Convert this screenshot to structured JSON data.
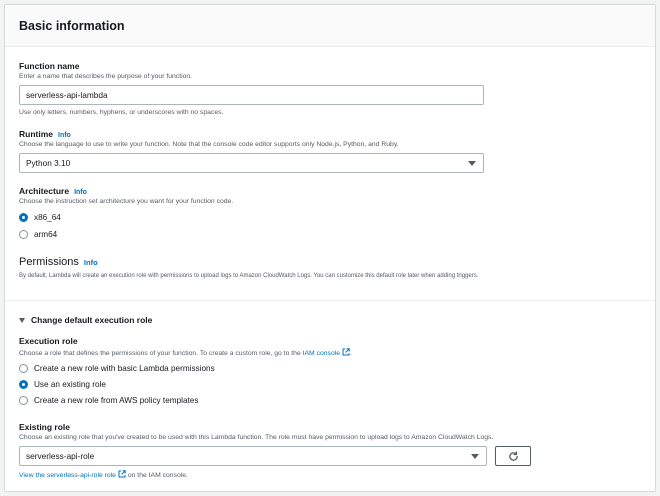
{
  "header": {
    "title": "Basic information"
  },
  "function_name": {
    "label": "Function name",
    "description": "Enter a name that describes the purpose of your function.",
    "value": "serverless-api-lambda",
    "hint": "Use only letters, numbers, hyphens, or underscores with no spaces."
  },
  "runtime": {
    "label": "Runtime",
    "info": "Info",
    "description": "Choose the language to use to write your function. Note that the console code editor supports only Node.js, Python, and Ruby.",
    "selected": "Python 3.10"
  },
  "architecture": {
    "label": "Architecture",
    "info": "Info",
    "description": "Choose the instruction set architecture you want for your function code.",
    "options": [
      {
        "label": "x86_64",
        "checked": true
      },
      {
        "label": "arm64",
        "checked": false
      }
    ]
  },
  "permissions": {
    "title": "Permissions",
    "info": "Info",
    "description": "By default, Lambda will create an execution role with permissions to upload logs to Amazon CloudWatch Logs. You can customize this default role later when adding triggers."
  },
  "execution_role_toggle": {
    "label": "Change default execution role"
  },
  "execution_role": {
    "label": "Execution role",
    "description_prefix": "Choose a role that defines the permissions of your function. To create a custom role, go to the ",
    "iam_link": "IAM console",
    "description_suffix": ".",
    "options": [
      {
        "label": "Create a new role with basic Lambda permissions",
        "checked": false
      },
      {
        "label": "Use an existing role",
        "checked": true
      },
      {
        "label": "Create a new role from AWS policy templates",
        "checked": false
      }
    ]
  },
  "existing_role": {
    "label": "Existing role",
    "description": "Choose an existing role that you've created to be used with this Lambda function. The role must have permission to upload logs to Amazon CloudWatch Logs.",
    "selected": "serverless-api-role",
    "view_link": "View the serverless-api-role role",
    "view_suffix": " on the IAM console."
  },
  "colors": {
    "accent": "#0073bb",
    "text": "#16191f",
    "muted": "#545b64",
    "border": "#aab7b8"
  },
  "icons": {
    "external": "external-link-icon",
    "refresh": "refresh-icon",
    "caret": "caret-down-icon"
  }
}
